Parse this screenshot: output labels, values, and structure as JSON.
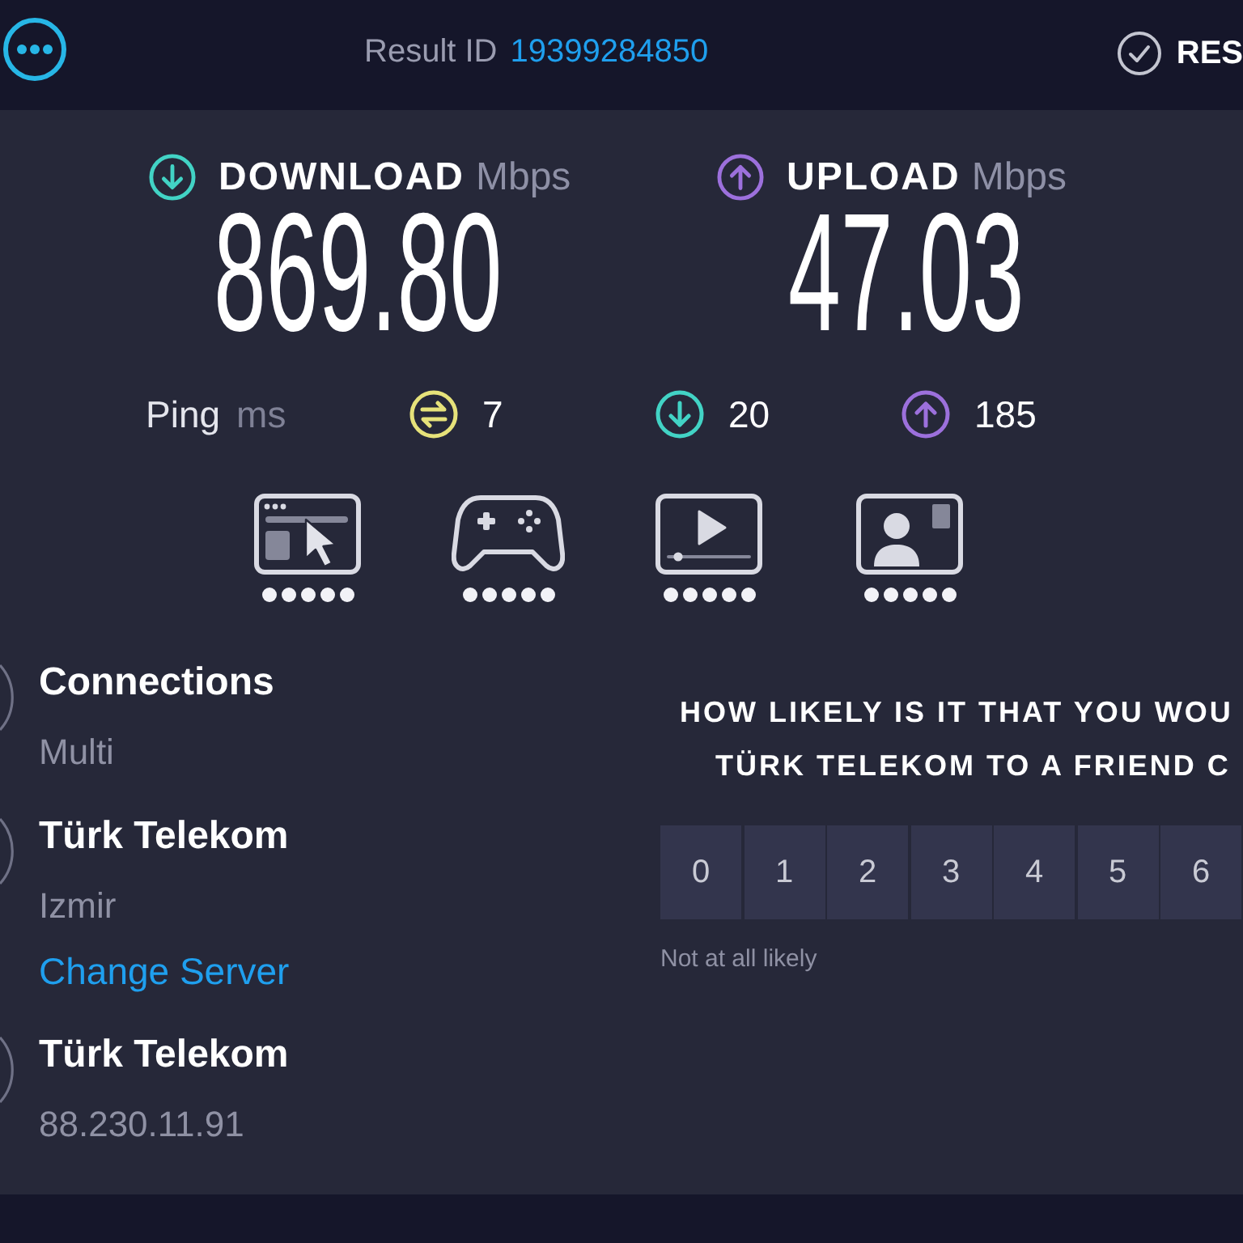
{
  "top_bar": {
    "result_label": "Result ID",
    "result_id": "19399284850",
    "results_link": "RES"
  },
  "download": {
    "label": "DOWNLOAD",
    "unit": "Mbps",
    "value": "869.80"
  },
  "upload": {
    "label": "UPLOAD",
    "unit": "Mbps",
    "value": "47.03"
  },
  "ping": {
    "label": "Ping",
    "unit": "ms",
    "readings": [
      {
        "kind": "idle",
        "value": "7"
      },
      {
        "kind": "download",
        "value": "20"
      },
      {
        "kind": "upload",
        "value": "185"
      }
    ]
  },
  "ratings": [
    {
      "kind": "browsing",
      "stars": 5
    },
    {
      "kind": "gaming",
      "stars": 5
    },
    {
      "kind": "streaming",
      "stars": 5
    },
    {
      "kind": "video_call",
      "stars": 5
    }
  ],
  "details": [
    {
      "title": "Connections",
      "lines": [
        {
          "kind": "text",
          "text": "Multi"
        }
      ]
    },
    {
      "title": "Türk Telekom",
      "lines": [
        {
          "kind": "text",
          "text": "Izmir"
        },
        {
          "kind": "link",
          "text": "Change Server"
        }
      ]
    },
    {
      "title": "Türk Telekom",
      "lines": [
        {
          "kind": "text",
          "text": "88.230.11.91"
        }
      ]
    }
  ],
  "survey": {
    "question_lines": [
      "HOW LIKELY IS IT THAT YOU WOU",
      "TÜRK TELEKOM TO A FRIEND C"
    ],
    "scale": [
      {
        "label": "0",
        "selected": false
      },
      {
        "label": "1",
        "selected": false
      },
      {
        "label": "2",
        "selected": false
      },
      {
        "label": "3",
        "selected": false
      },
      {
        "label": "4",
        "selected": false
      },
      {
        "label": "5",
        "selected": false
      },
      {
        "label": "6",
        "selected": false
      }
    ],
    "low_label": "Not at all likely"
  }
}
